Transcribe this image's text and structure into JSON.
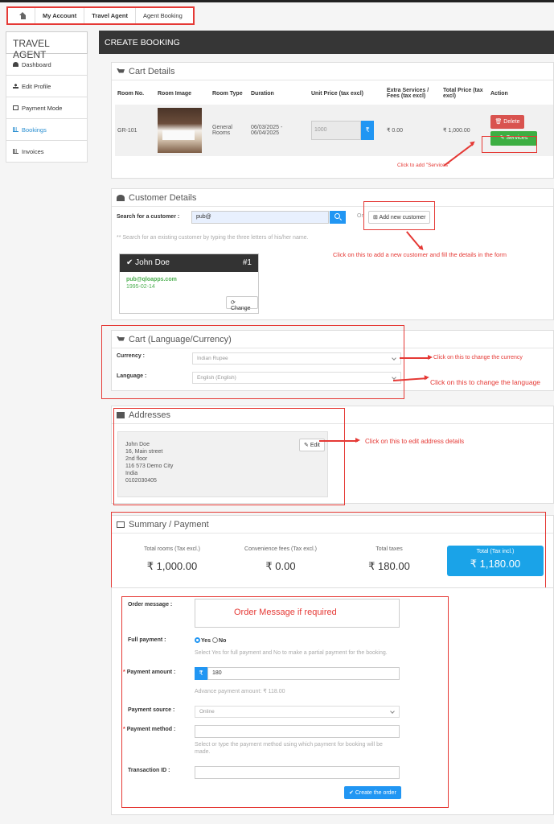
{
  "breadcrumb": {
    "home_icon": "home-icon",
    "items": [
      "My Account",
      "Travel Agent",
      "Agent Booking"
    ]
  },
  "sidebar": {
    "title": "TRAVEL AGENT",
    "items": [
      {
        "label": "Dashboard",
        "icon": "dashboard-icon"
      },
      {
        "label": "Edit Profile",
        "icon": "user-icon"
      },
      {
        "label": "Payment Mode",
        "icon": "money-icon"
      },
      {
        "label": "Bookings",
        "icon": "bar-chart-icon",
        "active": true
      },
      {
        "label": "Invoices",
        "icon": "bar-chart-icon"
      }
    ]
  },
  "header": {
    "title": "CREATE BOOKING"
  },
  "cart": {
    "title": "Cart Details",
    "columns": [
      "Room No.",
      "Room Image",
      "Room Type",
      "Duration",
      "Unit Price (tax excl)",
      "Extra Services / Fees (tax excl)",
      "Total Price (tax excl)",
      "Action"
    ],
    "row": {
      "room_no": "GR-101",
      "room_type": "General Rooms",
      "duration": "06/03/2025 - 06/04/2025",
      "unit_price": "1000",
      "currency_symbol": "₹",
      "extra": "₹ 0.00",
      "total": "₹ 1,000.00",
      "delete_label": "Delete",
      "services_label": "Services"
    },
    "annotation": "Click to add \"Services\""
  },
  "customer": {
    "title": "Customer Details",
    "search_label": "Search for a customer :",
    "search_value": "pub@",
    "or": "Or",
    "add_new_label": "Add new customer",
    "help": "** Search for an existing customer by typing the three letters of his/her name.",
    "card": {
      "name": "John Doe",
      "number": "#1",
      "email": "pub@qloapps.com",
      "dob": "1995-02-14",
      "change_label": "Change"
    },
    "annotation": "Click on this to add a new customer and fill the details in the form"
  },
  "lang_currency": {
    "title": "Cart (Language/Currency)",
    "currency_label": "Currency :",
    "currency_value": "Indian Rupee",
    "language_label": "Language :",
    "language_value": "English (English)",
    "currency_note": "Click on this to change the currency",
    "language_note": "Click on this to change the language"
  },
  "addresses": {
    "title": "Addresses",
    "lines": [
      "John Doe",
      "16, Main street",
      "2nd floor",
      "116 573 Demo City",
      "India",
      "0102030405"
    ],
    "edit_label": "Edit",
    "annotation": "Click on this to edit address details"
  },
  "summary": {
    "title": "Summary / Payment",
    "rooms_label": "Total rooms (Tax excl.)",
    "rooms_value": "₹ 1,000.00",
    "fees_label": "Convenience fees (Tax excl.)",
    "fees_value": "₹ 0.00",
    "taxes_label": "Total taxes",
    "taxes_value": "₹ 180.00",
    "total_label": "Total (Tax incl.)",
    "total_value": "₹ 1,180.00"
  },
  "order": {
    "message_label": "Order message :",
    "message_note": "Order Message if required",
    "full_payment_label": "Full payment :",
    "yes": "Yes",
    "no": "No",
    "full_payment_help": "Select Yes for full payment and No to make a partial payment for the booking.",
    "amount_label": "Payment amount :",
    "amount_value": "180",
    "amount_help": "Advance payment amount: ₹ 118.00",
    "source_label": "Payment source :",
    "source_value": "Online",
    "method_label": "Payment method :",
    "method_help": "Select or type the payment method using which payment for booking will be made.",
    "txn_label": "Transaction ID :",
    "create_label": "Create the order",
    "required_mark": "*"
  }
}
